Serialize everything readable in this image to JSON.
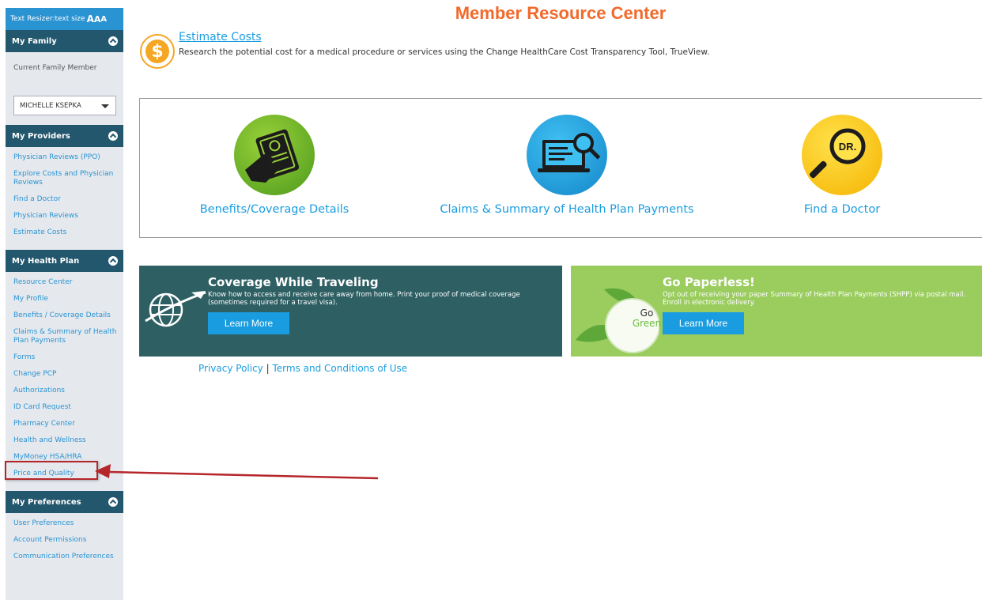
{
  "colors": {
    "accent": "#2a93d2",
    "section_header": "#23576d",
    "title": "#f26a2b",
    "highlight": "#b5262b"
  },
  "resizer": {
    "label": "Text Resizer:text size",
    "a_large": "A",
    "a_medium": "A",
    "a_small": "A"
  },
  "sidebar": {
    "family": {
      "title": "My Family",
      "current_label": "Current Family Member",
      "selected_member": "MICHELLE KSEPKA"
    },
    "providers": {
      "title": "My Providers",
      "items": [
        "Physician Reviews (PPO)",
        "Explore Costs and Physician Reviews",
        "Find a Doctor",
        "Physician Reviews",
        "Estimate Costs"
      ]
    },
    "health_plan": {
      "title": "My Health Plan",
      "items": [
        "Resource Center",
        "My Profile",
        "Benefits / Coverage Details",
        "Claims & Summary of Health Plan Payments",
        "Forms",
        "Change PCP",
        "Authorizations",
        "ID Card Request",
        "Pharmacy Center",
        "Health and Wellness",
        "MyMoney HSA/HRA",
        "Price and Quality"
      ]
    },
    "preferences": {
      "title": "My Preferences",
      "items": [
        "User Preferences",
        "Account Permissions",
        "Communication Preferences"
      ]
    }
  },
  "main": {
    "title": "Member Resource Center",
    "estimate": {
      "link": "Estimate Costs",
      "description": "Research the potential cost for a medical procedure or services using the Change HealthCare Cost Transparency Tool, TrueView.",
      "icon": "dollar-icon",
      "icon_glyph": "$"
    },
    "tiles": [
      {
        "label": "Benefits/Coverage Details",
        "icon": "coverage-card-icon"
      },
      {
        "label": "Claims & Summary of Health Plan Payments",
        "icon": "claims-laptop-icon"
      },
      {
        "label": "Find a Doctor",
        "icon": "find-doctor-icon",
        "icon_text": "DR."
      }
    ],
    "banners": {
      "travel": {
        "title": "Coverage While Traveling",
        "text": "Know how to access and receive care away from home. Print your proof of medical coverage (sometimes required for a travel visa).",
        "button": "Learn More",
        "icon": "globe-plane-icon"
      },
      "paperless": {
        "title": "Go Paperless!",
        "text": "Opt out of receiving your paper Summary of Health Plan Payments (SHPP) via postal mail. Enroll in electronic delivery.",
        "button": "Learn More",
        "badge_line1": "Go",
        "badge_line2": "Green",
        "icon": "go-green-leaf-icon"
      }
    },
    "footer": {
      "privacy": "Privacy Policy",
      "separator": "|",
      "terms": "Terms and Conditions of Use"
    }
  },
  "annotation": {
    "icon": "annotation-arrow-icon"
  }
}
